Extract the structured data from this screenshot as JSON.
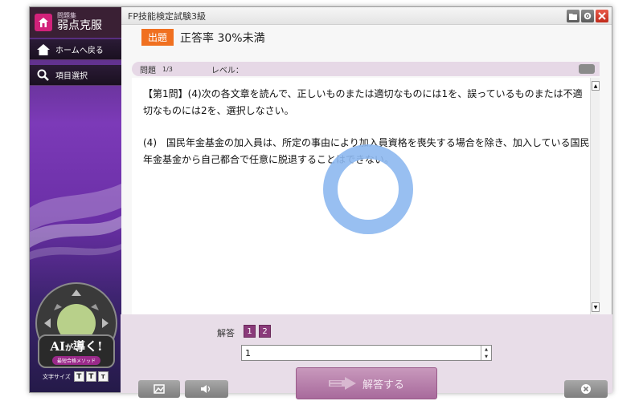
{
  "window": {
    "title": "FP技能検定試験3級"
  },
  "sidebar": {
    "app_small": "問題集",
    "app_big": "弱点克服",
    "items": [
      {
        "label": "ホームへ戻る",
        "icon": "home-icon"
      },
      {
        "label": "項目選択",
        "icon": "magnifier-icon"
      }
    ],
    "ai_badge": {
      "main": "AI",
      "ga": "が",
      "rest": "導く!",
      "sub": "最短合格メソッド"
    },
    "font_size": {
      "label": "文字サイズ",
      "buttons": [
        "T",
        "T",
        "T"
      ]
    }
  },
  "subject": {
    "tag": "出題",
    "text": "正答率 30%未満"
  },
  "question_bar": {
    "label": "問題",
    "number": "1/3",
    "level_label": "レベル："
  },
  "question": {
    "instruction": "【第1問】(4)次の各文章を読んで、正しいものまたは適切なものには1を、誤っているものまたは不適切なものには2を、選択しなさい。",
    "body": "(4)　国民年金基金の加入員は、所定の事由により加入員資格を喪失する場合を除き、加入している国民年金基金から自己都合で任意に脱退することはできない。"
  },
  "answer": {
    "label": "解答",
    "choices": [
      "1",
      "2"
    ],
    "input_value": "1",
    "submit_label": "解答する"
  },
  "colors": {
    "accent": "#f07020",
    "answer_choice": "#8a3a7a",
    "spinner": "#8db8f0",
    "sidebar_top": "#3a2034"
  }
}
